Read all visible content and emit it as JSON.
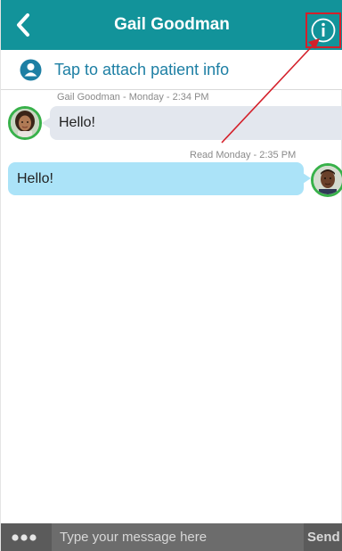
{
  "header": {
    "title": "Gail Goodman",
    "back_icon": "chevron-left-icon",
    "info_icon": "info-circle-icon",
    "background": "#12939a"
  },
  "attach_bar": {
    "label": "Tap to attach patient info",
    "icon": "patient-icon",
    "text_color": "#1d7fa4"
  },
  "messages": [
    {
      "direction": "incoming",
      "meta": "Gail Goodman - Monday - 2:34 PM",
      "text": "Hello!",
      "bubble_color": "#e3e7ee"
    },
    {
      "direction": "outgoing",
      "meta": "Read  Monday - 2:35 PM",
      "text": "Hello!",
      "bubble_color": "#abe3f8"
    }
  ],
  "compose": {
    "more_icon": "more-dots-icon",
    "placeholder": "Type your message here",
    "send_label": "Send",
    "background": "#5b5b5b"
  },
  "annotation": {
    "highlight_color": "#d4202a"
  }
}
